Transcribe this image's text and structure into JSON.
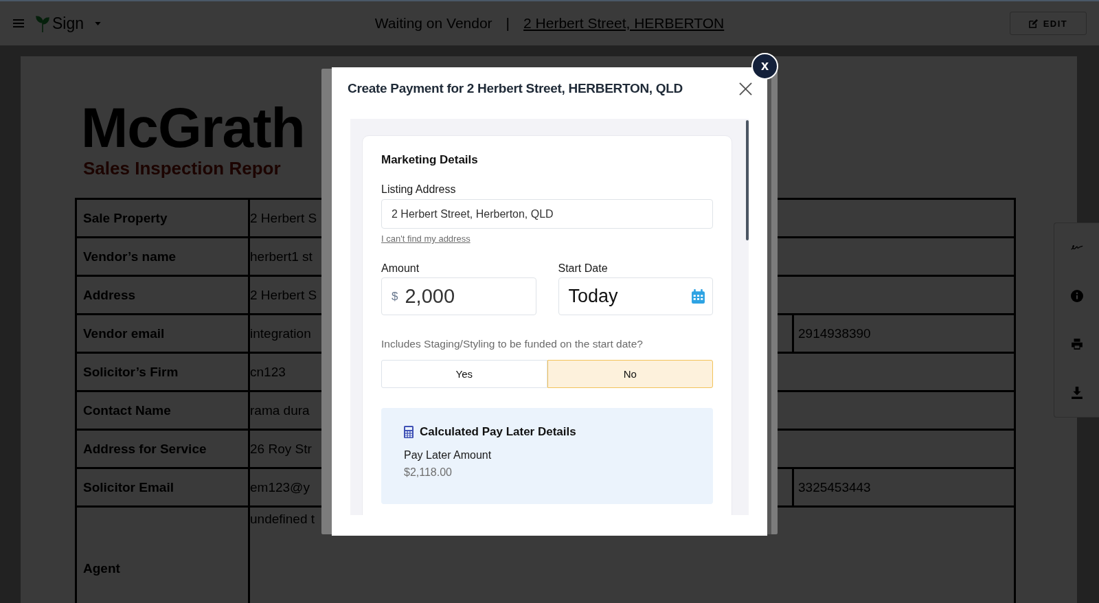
{
  "top_bar": {
    "app_name": "Sign",
    "status": "Waiting on Vendor",
    "separator": "|",
    "address_link": "2 Herbert Street, HERBERTON",
    "edit_button": "EDIT"
  },
  "document": {
    "logo": "McGrath",
    "subtitle": "Sales Inspection Repor",
    "rows": [
      {
        "kind": "standard",
        "label": "Sale Property",
        "value": "2 Herbert S"
      },
      {
        "kind": "standard",
        "label": "Vendor’s name",
        "value": "herbert1 st"
      },
      {
        "kind": "standard",
        "label": "Address",
        "value": "2 Herbert S"
      },
      {
        "kind": "standard",
        "label": "Vendor email",
        "value": "integration",
        "column_3": "2914938390"
      },
      {
        "kind": "standard",
        "label": "Solicitor’s Firm",
        "value": "cn123"
      },
      {
        "kind": "standard",
        "label": "Contact Name",
        "value": "rama dura"
      },
      {
        "kind": "standard",
        "label": "Address for Service",
        "value": "26 Roy Str"
      },
      {
        "kind": "standard",
        "label": "Solicitor Email",
        "value": "em123@y",
        "column_3": "3325453443"
      },
      {
        "kind": "tall",
        "label": "Agent",
        "value": "undefined t"
      }
    ]
  },
  "modal": {
    "dismiss_badge": "x",
    "title": "Create Payment for 2 Herbert Street, HERBERTON, QLD",
    "section_title": "Marketing Details",
    "listing_address": {
      "label": "Listing Address",
      "value": "2 Herbert Street, Herberton, QLD"
    },
    "address_help_link": "I can't find my address",
    "amount": {
      "label": "Amount",
      "currency": "$",
      "value": "2,000"
    },
    "start_date": {
      "label": "Start Date",
      "value": "Today"
    },
    "staging_question": "Includes Staging/Styling to be funded on the start date?",
    "staging_options": [
      {
        "label": "Yes",
        "selected": false
      },
      {
        "label": "No",
        "selected": true
      }
    ],
    "pay_later": {
      "title": "Calculated Pay Later Details",
      "label": "Pay Later Amount",
      "value": "$2,118.00"
    }
  }
}
